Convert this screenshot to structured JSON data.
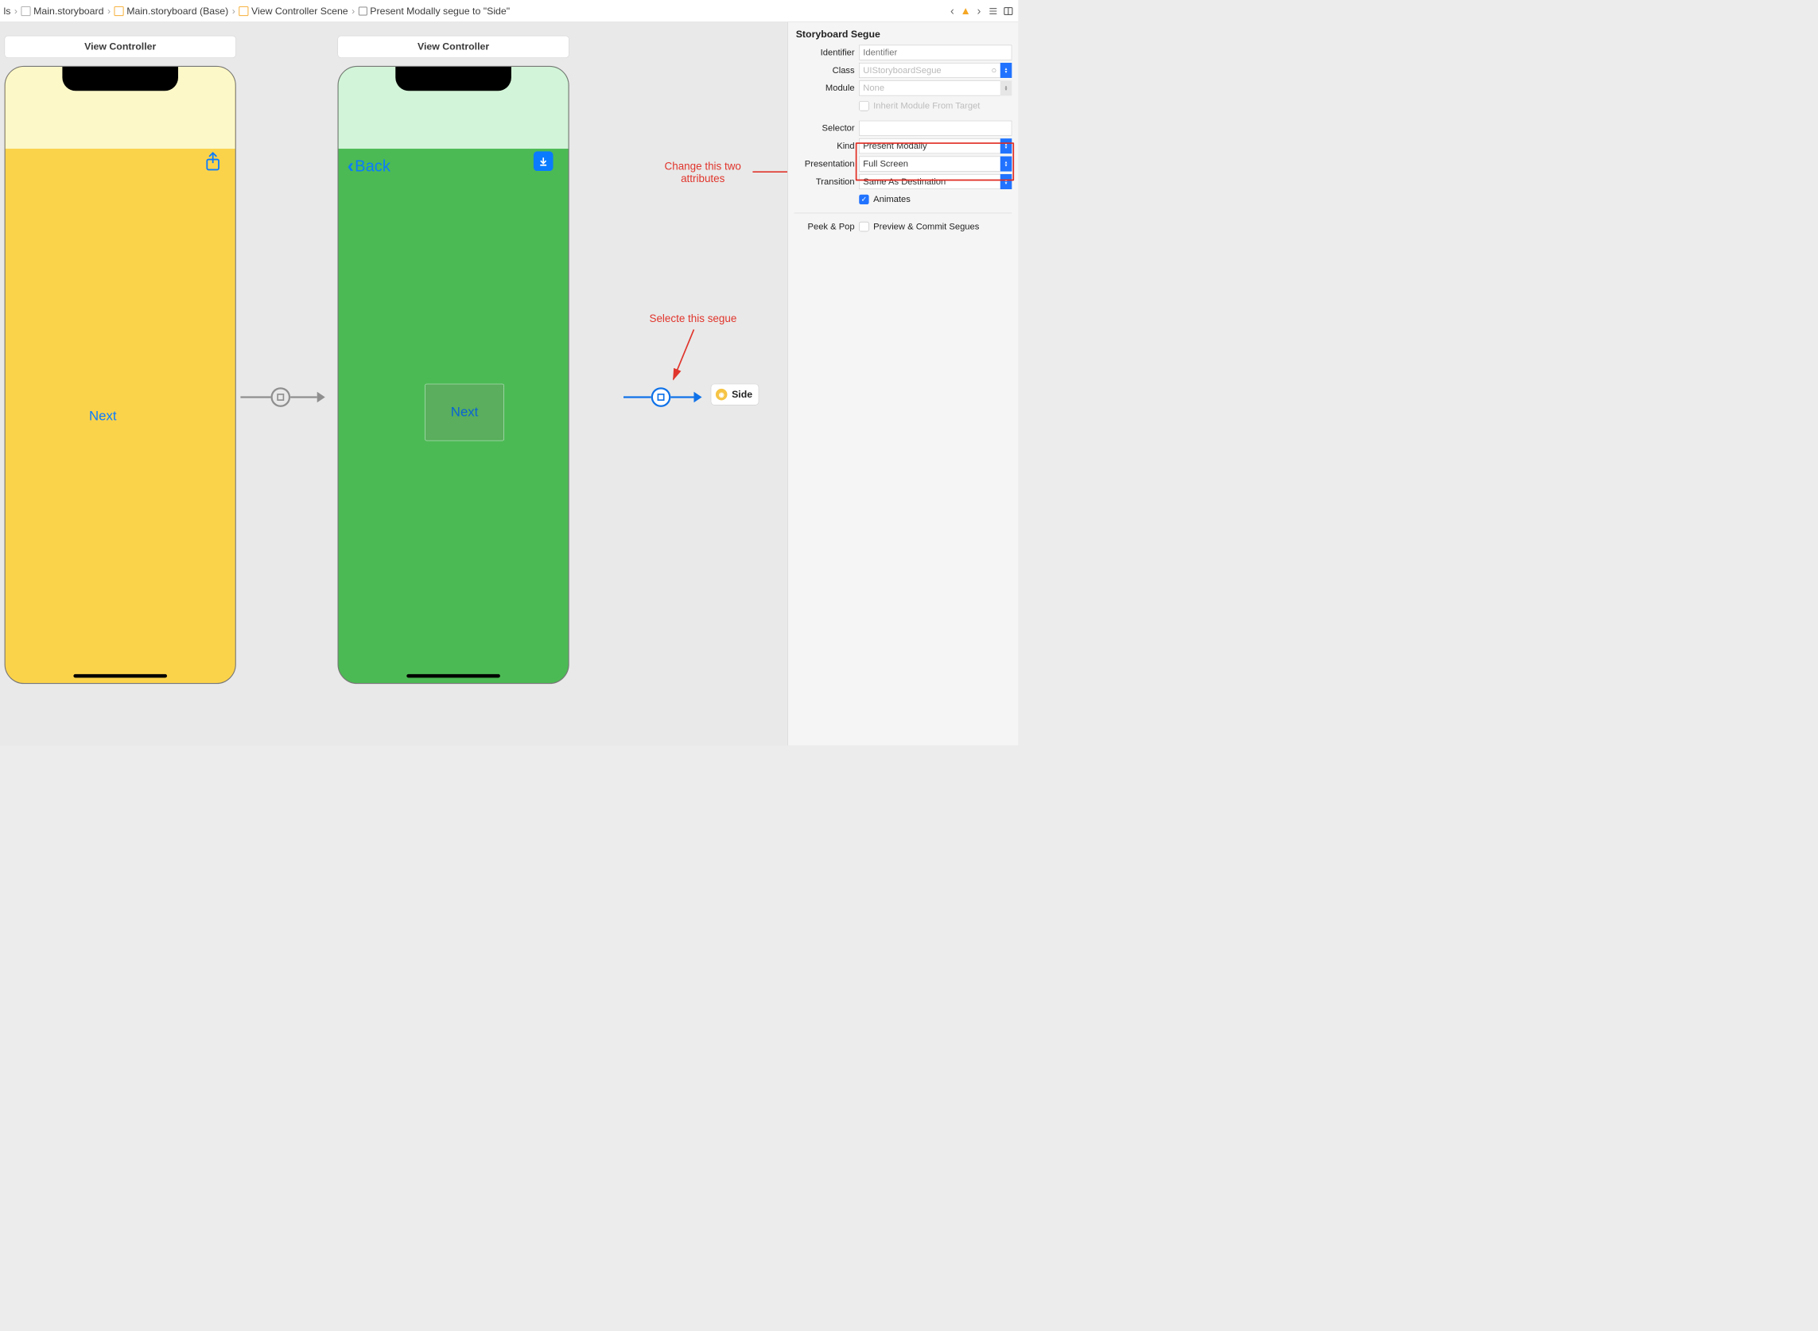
{
  "breadcrumbs": {
    "seg0_suffix": "ls",
    "seg1": "Main.storyboard",
    "seg2": "Main.storyboard (Base)",
    "seg3": "View Controller Scene",
    "seg4": "Present Modally segue to \"Side\""
  },
  "scenes": {
    "vc1_title": "View Controller",
    "vc2_title": "View Controller",
    "vc1_button": "Next",
    "vc2_button": "Next",
    "vc2_back": "Back",
    "side_chip": "Side"
  },
  "annotations": {
    "change_attrs": "Change this two\nattributes",
    "select_segue": "Selecte this segue"
  },
  "inspector": {
    "header": "Storyboard Segue",
    "identifier_label": "Identifier",
    "identifier_placeholder": "Identifier",
    "class_label": "Class",
    "class_value": "UIStoryboardSegue",
    "module_label": "Module",
    "module_value": "None",
    "inherit_label": "Inherit Module From Target",
    "selector_label": "Selector",
    "kind_label": "Kind",
    "kind_value": "Present Modally",
    "presentation_label": "Presentation",
    "presentation_value": "Full Screen",
    "transition_label": "Transition",
    "transition_value": "Same As Destination",
    "animates_label": "Animates",
    "peekpop_label": "Peek & Pop",
    "peekpop_value": "Preview & Commit Segues"
  }
}
